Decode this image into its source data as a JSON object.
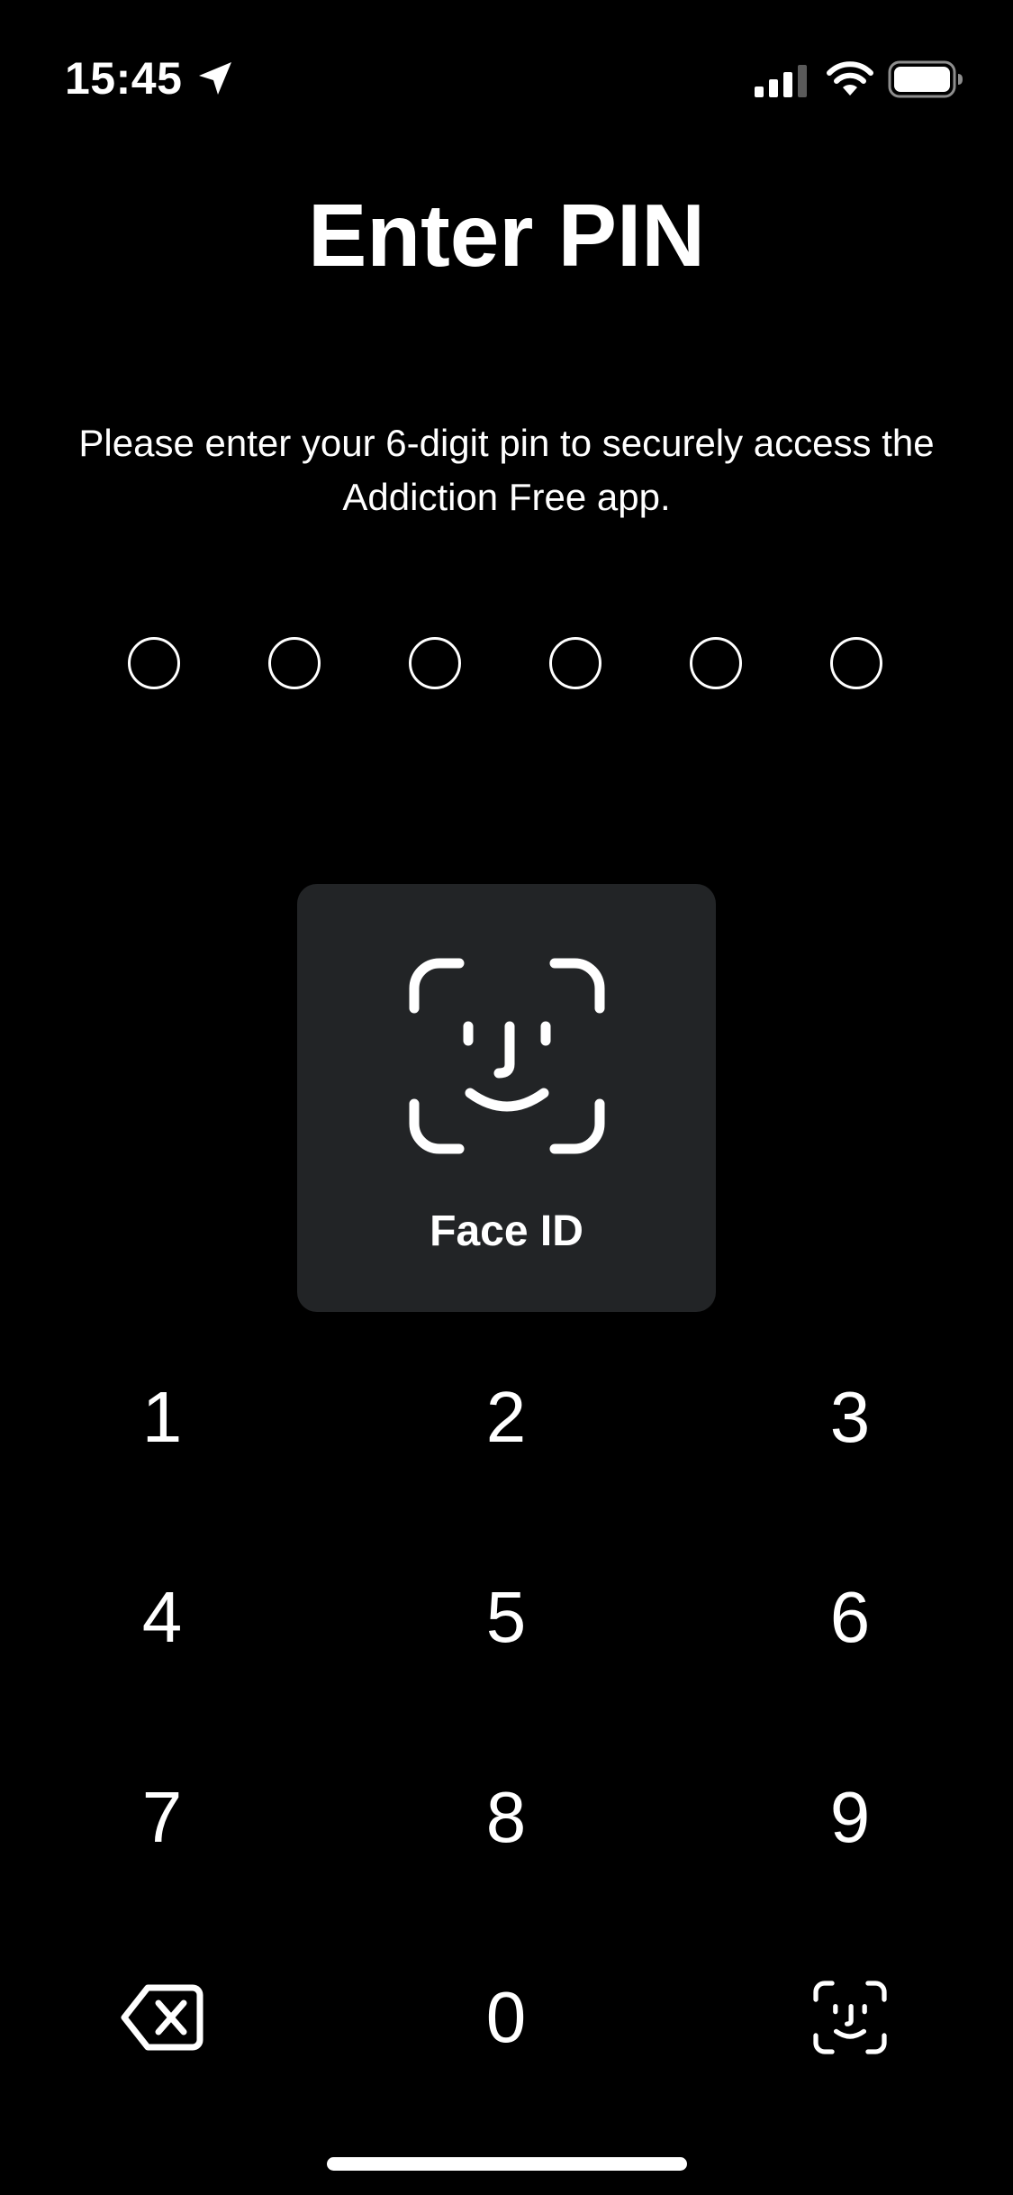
{
  "status_bar": {
    "time": "15:45",
    "icons": [
      "location-arrow-icon",
      "cellular-signal-icon",
      "wifi-icon",
      "battery-icon"
    ]
  },
  "title": "Enter PIN",
  "subtitle": "Please enter your 6-digit pin to securely access the Addiction Free app.",
  "pin": {
    "length": 6,
    "filled": 0
  },
  "face_id_prompt": {
    "icon": "face-id-icon",
    "label": "Face ID"
  },
  "keypad": {
    "keys": [
      "1",
      "2",
      "3",
      "4",
      "5",
      "6",
      "7",
      "8",
      "9",
      "0"
    ],
    "delete_icon": "backspace-icon",
    "biometric_icon": "face-id-icon"
  },
  "colors": {
    "background": "#000000",
    "text": "#ffffff",
    "card": "#222426"
  }
}
